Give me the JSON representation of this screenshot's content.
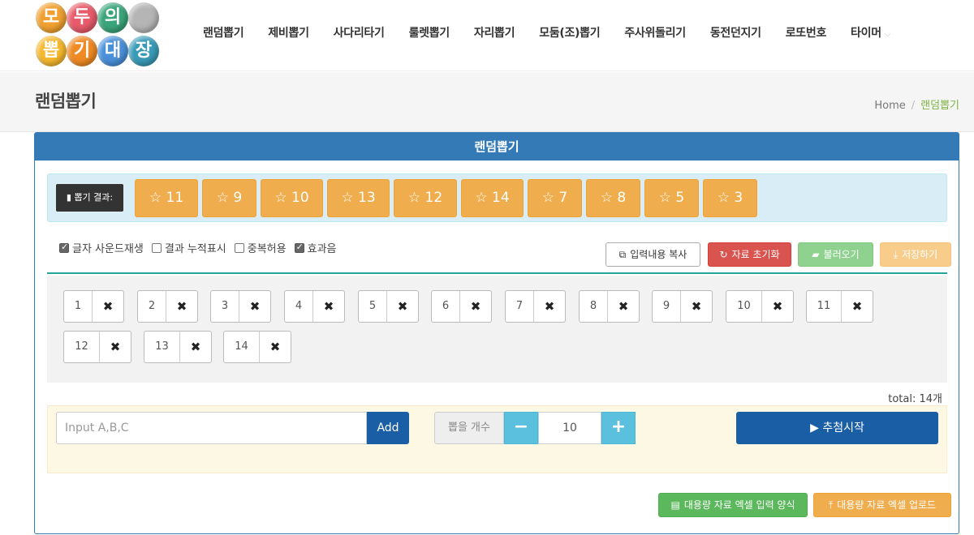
{
  "logo": {
    "chars": [
      "모",
      "두",
      "의",
      "",
      "뽑",
      "기",
      "대",
      "장"
    ],
    "colors": [
      "#f0a030",
      "#e85b6a",
      "#3aa57a",
      "#b5b5b5",
      "#f5b82e",
      "#f08a24",
      "#4a90d9",
      "#3a9bb8"
    ]
  },
  "nav": [
    "랜덤뽑기",
    "제비뽑기",
    "사다리타기",
    "룰렛뽑기",
    "자리뽑기",
    "모둠(조)뽑기",
    "주사위돌리기",
    "동전던지기",
    "로또번호",
    "타이머"
  ],
  "nav_more_icon": "chevron-down-icon",
  "page_title": "랜덤뽑기",
  "breadcrumb": {
    "home": "Home",
    "sep": "/",
    "current": "랜덤뽑기"
  },
  "panel": {
    "title": "랜덤뽑기",
    "result_label": "뽑기 결과:",
    "results": [
      "11",
      "9",
      "10",
      "13",
      "12",
      "14",
      "7",
      "8",
      "5",
      "3"
    ],
    "options": [
      {
        "label": "글자 사운드재생",
        "checked": true
      },
      {
        "label": "결과 누적표시",
        "checked": false
      },
      {
        "label": "중복허용",
        "checked": false
      },
      {
        "label": "효과음",
        "checked": true
      }
    ],
    "buttons": {
      "copy": "입력내용 복사",
      "reset": "자료 초기화",
      "load": "불러오기",
      "save": "저장하기"
    },
    "items": [
      "1",
      "2",
      "3",
      "4",
      "5",
      "6",
      "7",
      "8",
      "9",
      "10",
      "11",
      "12",
      "13",
      "14"
    ],
    "total": "total: 14개",
    "input_placeholder": "Input A,B,C",
    "add_label": "Add",
    "count_label": "뽑을 개수",
    "count_value": "10",
    "minus": "−",
    "plus": "+",
    "start_label": "추첨시작",
    "excel_form": "대용량 자료 엑셀 입력 양식",
    "excel_upload": "대용량 자료 엑셀 업로드"
  }
}
